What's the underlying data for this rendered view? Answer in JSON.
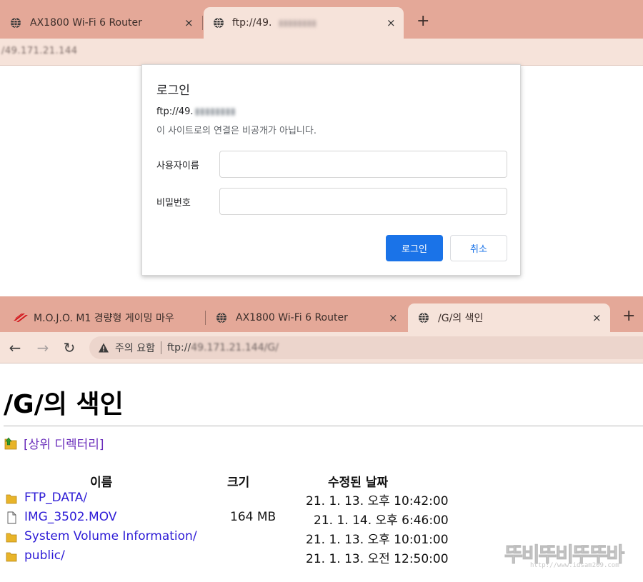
{
  "top": {
    "tabs": [
      {
        "title": "AX1800 Wi-Fi 6 Router",
        "close": "×"
      },
      {
        "title": "ftp://49.",
        "title_blurred": "▮▮▮▮▮▮▮▮",
        "close": "×"
      }
    ],
    "new_tab": "+",
    "address_blurred": "/49.171.21.144",
    "dialog": {
      "title": "로그인",
      "url_prefix": "ftp://49.",
      "url_blurred": "▮▮▮▮▮▮▮▮",
      "description": "이 사이트로의 연결은 비공개가 아닙니다.",
      "username_label": "사용자이름",
      "username_value": "",
      "password_label": "비밀번호",
      "password_value": "",
      "login_button": "로그인",
      "cancel_button": "취소"
    }
  },
  "bottom": {
    "tabs": [
      {
        "title": "M.O.J.O. M1 경량형 게이밍 마우",
        "icon": "mojo-logo-icon"
      },
      {
        "title": "AX1800 Wi-Fi 6 Router",
        "close": "×",
        "icon": "globe-icon"
      },
      {
        "title": "/G/의 색인",
        "close": "×",
        "icon": "globe-icon"
      }
    ],
    "new_tab": "+",
    "nav": {
      "back": "←",
      "forward": "→",
      "reload": "↻"
    },
    "omnibox": {
      "warning_label": "주의 요함",
      "url_prefix": "ftp://",
      "url_blurred": "49.171.21.144/G/"
    },
    "page": {
      "heading": "/G/의 색인",
      "parent_link": "[상위 디렉터리]",
      "columns": {
        "name": "이름",
        "size": "크기",
        "modified": "수정된 날짜"
      },
      "files": [
        {
          "name": "FTP_DATA/",
          "size": "",
          "date": "21. 1. 13. 오후 10:42:00",
          "type": "folder"
        },
        {
          "name": "IMG_3502.MOV",
          "size": "164 MB",
          "date": "21. 1. 14. 오후 6:46:00",
          "type": "file"
        },
        {
          "name": "System Volume Information/",
          "size": "",
          "date": "21. 1. 13. 오후 10:01:00",
          "type": "folder"
        },
        {
          "name": "public/",
          "size": "",
          "date": "21. 1. 13. 오전 12:50:00",
          "type": "folder"
        }
      ]
    },
    "watermark": {
      "main": "뚜비뚜비뚜뚜바",
      "sub": "http://www.idsam209.com"
    }
  },
  "colors": {
    "tabstrip": "#e4a898",
    "active_tab": "#f6e3da",
    "primary_button": "#1a73e8",
    "link": "#2d1bd6",
    "visited_link": "#6a2dbb",
    "folder": "#e8b429"
  }
}
